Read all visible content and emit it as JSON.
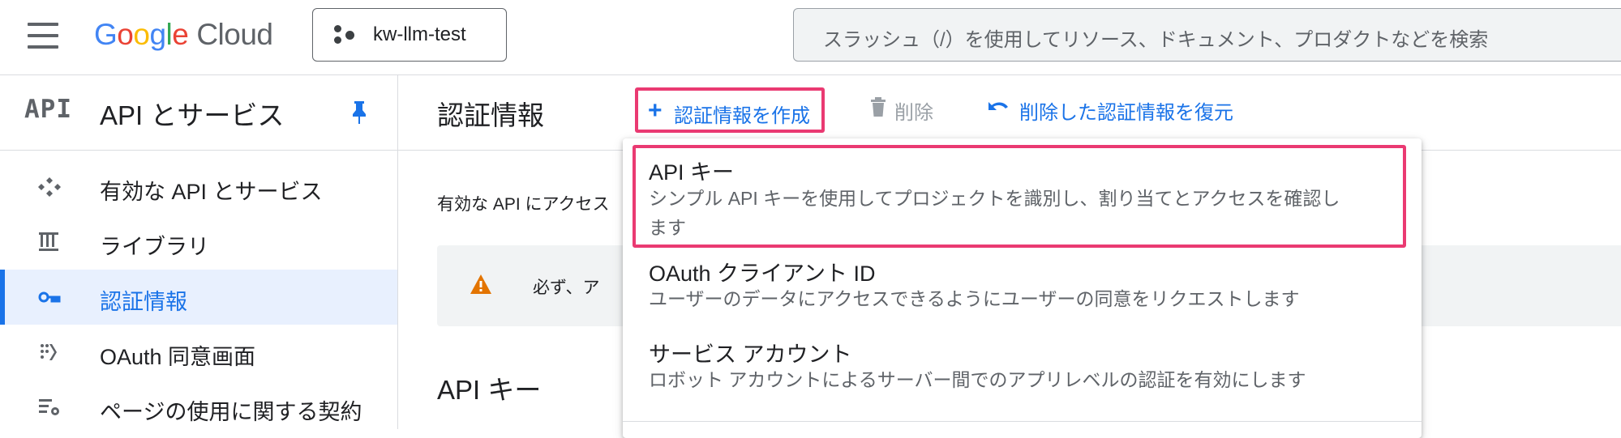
{
  "topbar": {
    "logo_google_letters": [
      "G",
      "o",
      "o",
      "g",
      "l",
      "e"
    ],
    "logo_cloud": "Cloud",
    "project": "kw-llm-test",
    "search_placeholder": "スラッシュ（/）を使用してリソース、ドキュメント、プロダクトなどを検索"
  },
  "sidebar": {
    "badge": "API",
    "title": "API とサービス",
    "items": [
      {
        "label": "有効な API とサービス",
        "icon": "api-services-icon",
        "active": false
      },
      {
        "label": "ライブラリ",
        "icon": "library-icon",
        "active": false
      },
      {
        "label": "認証情報",
        "icon": "key-icon",
        "active": true
      },
      {
        "label": "OAuth 同意画面",
        "icon": "oauth-consent-icon",
        "active": false
      },
      {
        "label": "ページの使用に関する契約",
        "icon": "page-usage-settings-icon",
        "active": false
      }
    ]
  },
  "main": {
    "title": "認証情報",
    "create_label": "認証情報を作成",
    "delete_label": "削除",
    "restore_label": "削除した認証情報を復元",
    "description": "有効な API にアクセス",
    "alert_text": "必ず、ア",
    "section_title": "API キー"
  },
  "dropdown": {
    "items": [
      {
        "title": "API キー",
        "description_lines": [
          "シンプル API キーを使用してプロジェクトを識別し、割り当てとアクセスを確認し",
          "ます"
        ]
      },
      {
        "title": "OAuth クライアント ID",
        "description_lines": [
          "ユーザーのデータにアクセスできるようにユーザーの同意をリクエストします"
        ]
      },
      {
        "title": "サービス アカウント",
        "description_lines": [
          "ロボット アカウントによるサーバー間でのアプリレベルの認証を有効にします"
        ]
      }
    ]
  },
  "colors": {
    "accent_blue": "#1a73e8",
    "highlight_pink": "#ea3a72",
    "warning_orange": "#e37400",
    "active_bg": "#e8f0fe"
  }
}
